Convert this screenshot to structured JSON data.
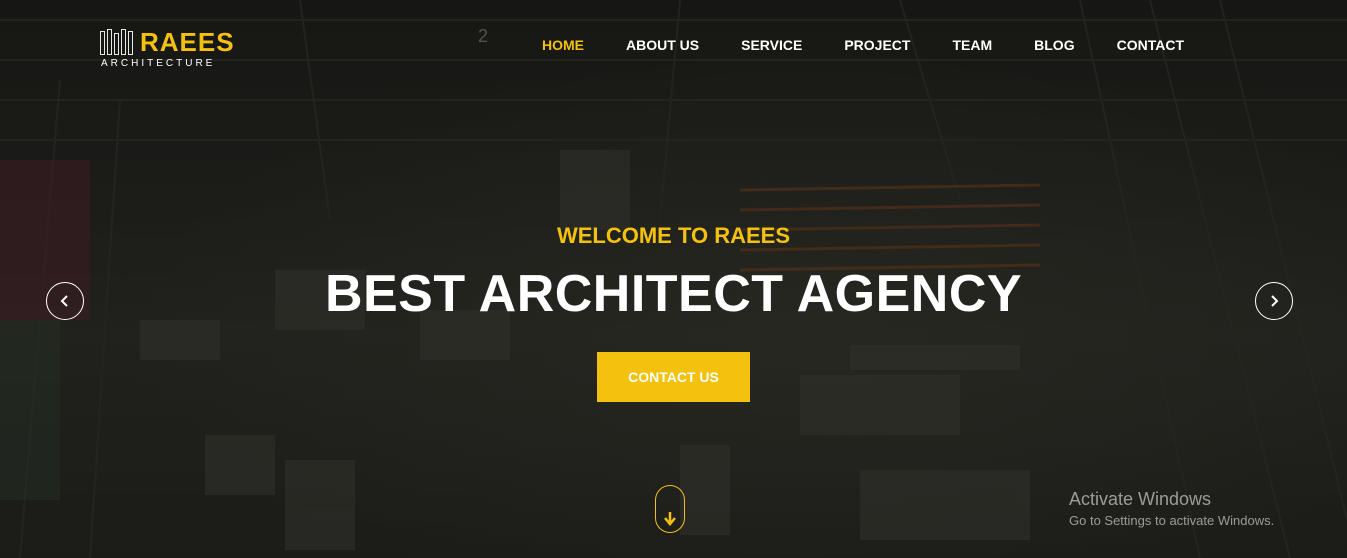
{
  "brand": {
    "name": "RAEES",
    "tagline": "ARCHITECTURE",
    "accent_color": "#f5c10f"
  },
  "nav": {
    "items": [
      {
        "label": "HOME",
        "active": true
      },
      {
        "label": "ABOUT US",
        "active": false
      },
      {
        "label": "SERVICE",
        "active": false
      },
      {
        "label": "PROJECT",
        "active": false
      },
      {
        "label": "TEAM",
        "active": false
      },
      {
        "label": "BLOG",
        "active": false
      },
      {
        "label": "CONTACT",
        "active": false
      }
    ]
  },
  "hero": {
    "welcome": "WELCOME TO RAEES",
    "headline": "BEST ARCHITECT AGENCY",
    "cta_label": "CONTACT US",
    "prev_icon": "chevron-left-icon",
    "next_icon": "chevron-right-icon",
    "scroll_icon": "arrow-down-icon"
  },
  "windows_watermark": {
    "title": "Activate Windows",
    "subtitle": "Go to Settings to activate Windows."
  }
}
